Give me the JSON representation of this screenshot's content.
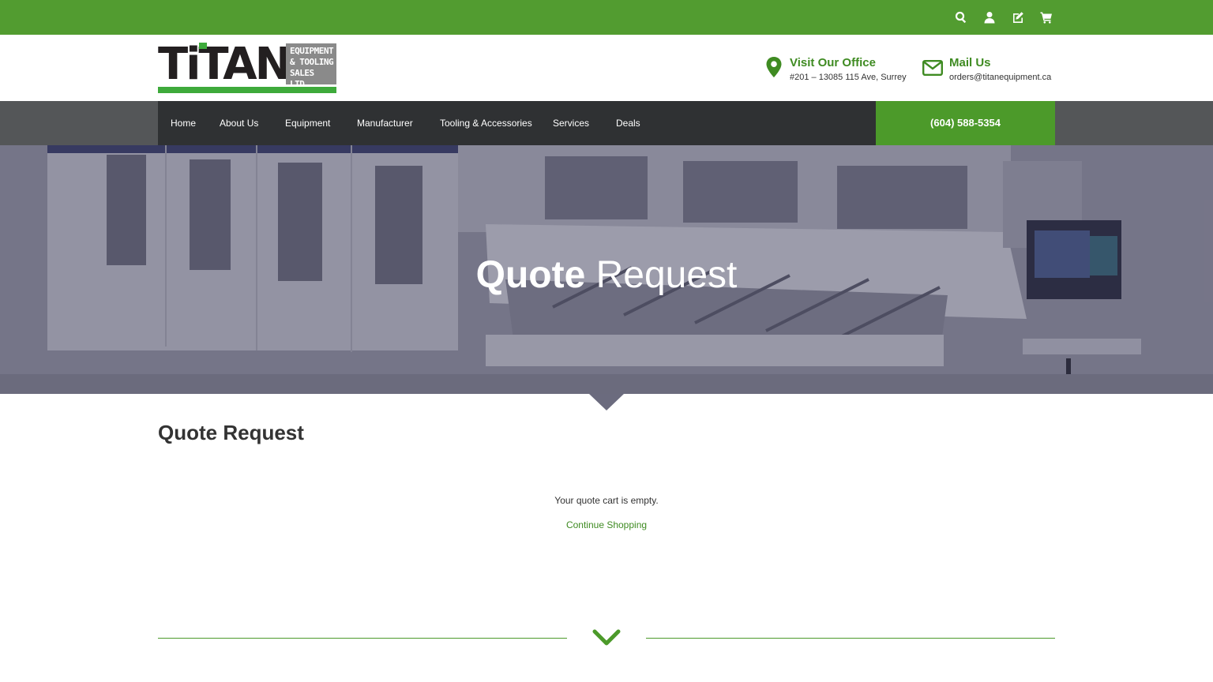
{
  "topbar": {
    "icons": [
      "search-icon",
      "user-icon",
      "edit-icon",
      "cart-icon"
    ],
    "color": "#529c30"
  },
  "logo": {
    "word": "TiTAN",
    "box_lines": [
      "EQUIPMENT",
      "& TOOLING",
      "SALES LTD."
    ]
  },
  "contact": {
    "office": {
      "title": "Visit Our Office",
      "subtitle": "#201 – 13085 115 Ave, Surrey",
      "icon": "map-pin-icon"
    },
    "mail": {
      "title": "Mail Us",
      "subtitle": "orders@titanequipment.ca",
      "icon": "envelope-icon"
    }
  },
  "nav": {
    "items": [
      {
        "label": "Home"
      },
      {
        "label": "About Us"
      },
      {
        "label": "Equipment"
      },
      {
        "label": "Manufacturer"
      },
      {
        "label": "Tooling & Accessories"
      },
      {
        "label": "Services"
      },
      {
        "label": "Deals"
      }
    ],
    "phone": "(604) 588-5354"
  },
  "hero": {
    "title_bold": "Quote",
    "title_light": "Request"
  },
  "main": {
    "heading": "Quote Request",
    "empty_message": "Your quote cart is empty.",
    "continue_label": "Continue Shopping"
  },
  "colors": {
    "brand_green": "#529c30",
    "link_green": "#3f8b22",
    "nav_dark": "#2f3133"
  }
}
